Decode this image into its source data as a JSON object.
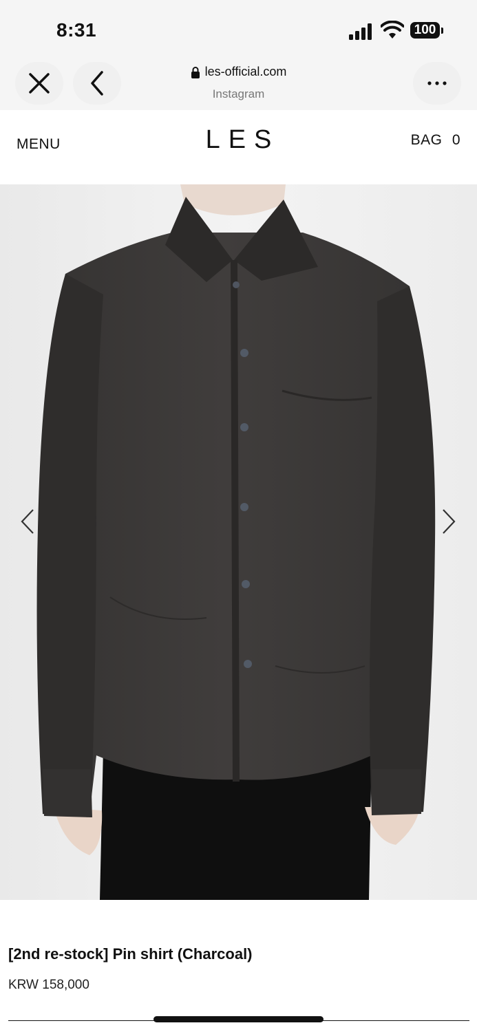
{
  "status_bar": {
    "time": "8:31",
    "battery": "100",
    "icons": [
      "cellular-signal-icon",
      "wifi-icon",
      "battery-icon"
    ]
  },
  "browser": {
    "url": "les-official.com",
    "subtitle": "Instagram",
    "icons": [
      "close-icon",
      "back-chevron-icon",
      "lock-icon",
      "more-dots-icon"
    ]
  },
  "header": {
    "menu_label": "MENU",
    "logo": "LES",
    "bag_label": "BAG",
    "bag_count": "0"
  },
  "gallery": {
    "icons": [
      "chevron-left-icon",
      "chevron-right-icon"
    ]
  },
  "product": {
    "title": "[2nd re-stock] Pin shirt (Charcoal)",
    "price": "KRW 158,000"
  },
  "colors": {
    "shirt": "#3a3837",
    "background": "#efefef",
    "chrome": "#f5f5f5"
  }
}
